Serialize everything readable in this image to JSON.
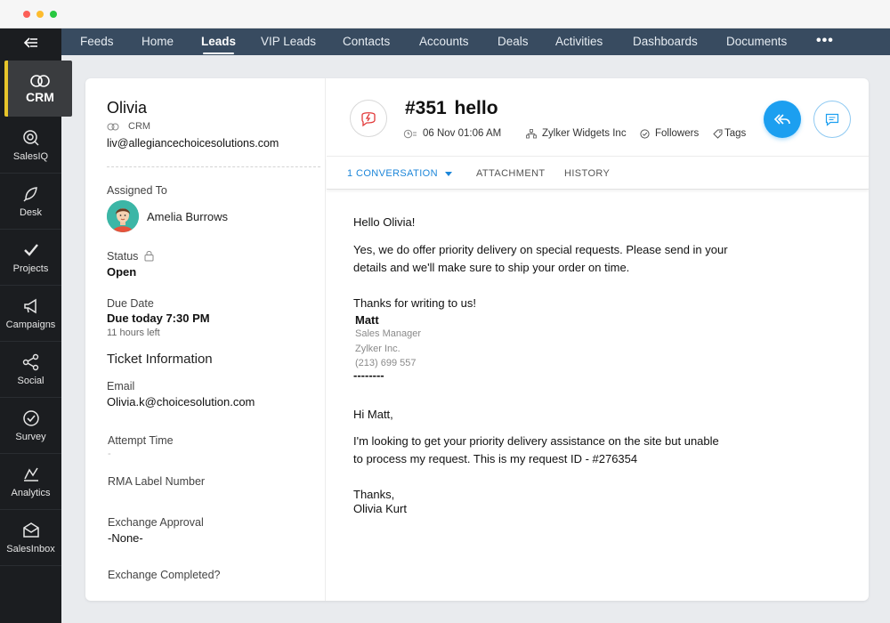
{
  "window": {
    "colors": {
      "close": "#fc5f57",
      "minimize": "#fdbc2e",
      "maximize": "#28c840"
    }
  },
  "rail": {
    "back_icon": "back-arrow-icon",
    "items": [
      {
        "label": "CRM",
        "icon": "crm-rings-icon",
        "active": true
      },
      {
        "label": "SalesIQ",
        "icon": "salesiq-icon"
      },
      {
        "label": "Desk",
        "icon": "desk-icon"
      },
      {
        "label": "Projects",
        "icon": "check-icon"
      },
      {
        "label": "Campaigns",
        "icon": "megaphone-icon"
      },
      {
        "label": "Social",
        "icon": "share-icon"
      },
      {
        "label": "Survey",
        "icon": "check-circle-icon"
      },
      {
        "label": "Analytics",
        "icon": "analytics-icon"
      },
      {
        "label": "SalesInbox",
        "icon": "inbox-icon"
      }
    ]
  },
  "nav": {
    "items": [
      "Feeds",
      "Home",
      "Leads",
      "VIP Leads",
      "Contacts",
      "Accounts",
      "Deals",
      "Activities",
      "Dashboards",
      "Documents"
    ],
    "active": "Leads",
    "more": "•••"
  },
  "contact": {
    "name": "Olivia",
    "source": "CRM",
    "email": "liv@allegiancechoicesolutions.com",
    "assigned_to_label": "Assigned To",
    "assignee": "Amelia Burrows",
    "status_label": "Status",
    "status_value": "Open",
    "due_label": "Due Date",
    "due_value": "Due today 7:30 PM",
    "due_sub": "11 hours left",
    "section_title": "Ticket Information",
    "fields": [
      {
        "label": "Email",
        "value": "Olivia.k@choicesolution.com"
      },
      {
        "label": "Attempt Time",
        "value": "-"
      },
      {
        "label": "RMA Label Number",
        "value": ""
      },
      {
        "label": "Exchange Approval",
        "value": "-None-"
      },
      {
        "label": "Exchange Completed?",
        "value": ""
      }
    ]
  },
  "ticket": {
    "title": "#351  hello",
    "date": "06 Nov 01:06 AM",
    "account": "Zylker Widgets Inc",
    "followers": "Followers",
    "tags": "Tags",
    "colors": {
      "accent": "#1c9ff0",
      "ticket_icon": "#e23a3a"
    }
  },
  "tabs": [
    {
      "label": "1 CONVERSATION",
      "active": true
    },
    {
      "label": "ATTACHMENT"
    },
    {
      "label": "HISTORY"
    }
  ],
  "conversation": {
    "lines": [
      "Hello Olivia!",
      "Yes, we do offer priority delivery on special requests. Please send in your",
      "details and we'll make sure to ship your order on time.",
      "Thanks for writing to us!",
      "Matt",
      "Sales Manager",
      "Zylker Inc.",
      "(213) 699 557",
      "--------",
      "Hi Matt,",
      "I'm looking to get your priority delivery assistance on the site but unable",
      "to process my request. This is my request ID - #276354",
      "Thanks,",
      "Olivia Kurt"
    ]
  }
}
